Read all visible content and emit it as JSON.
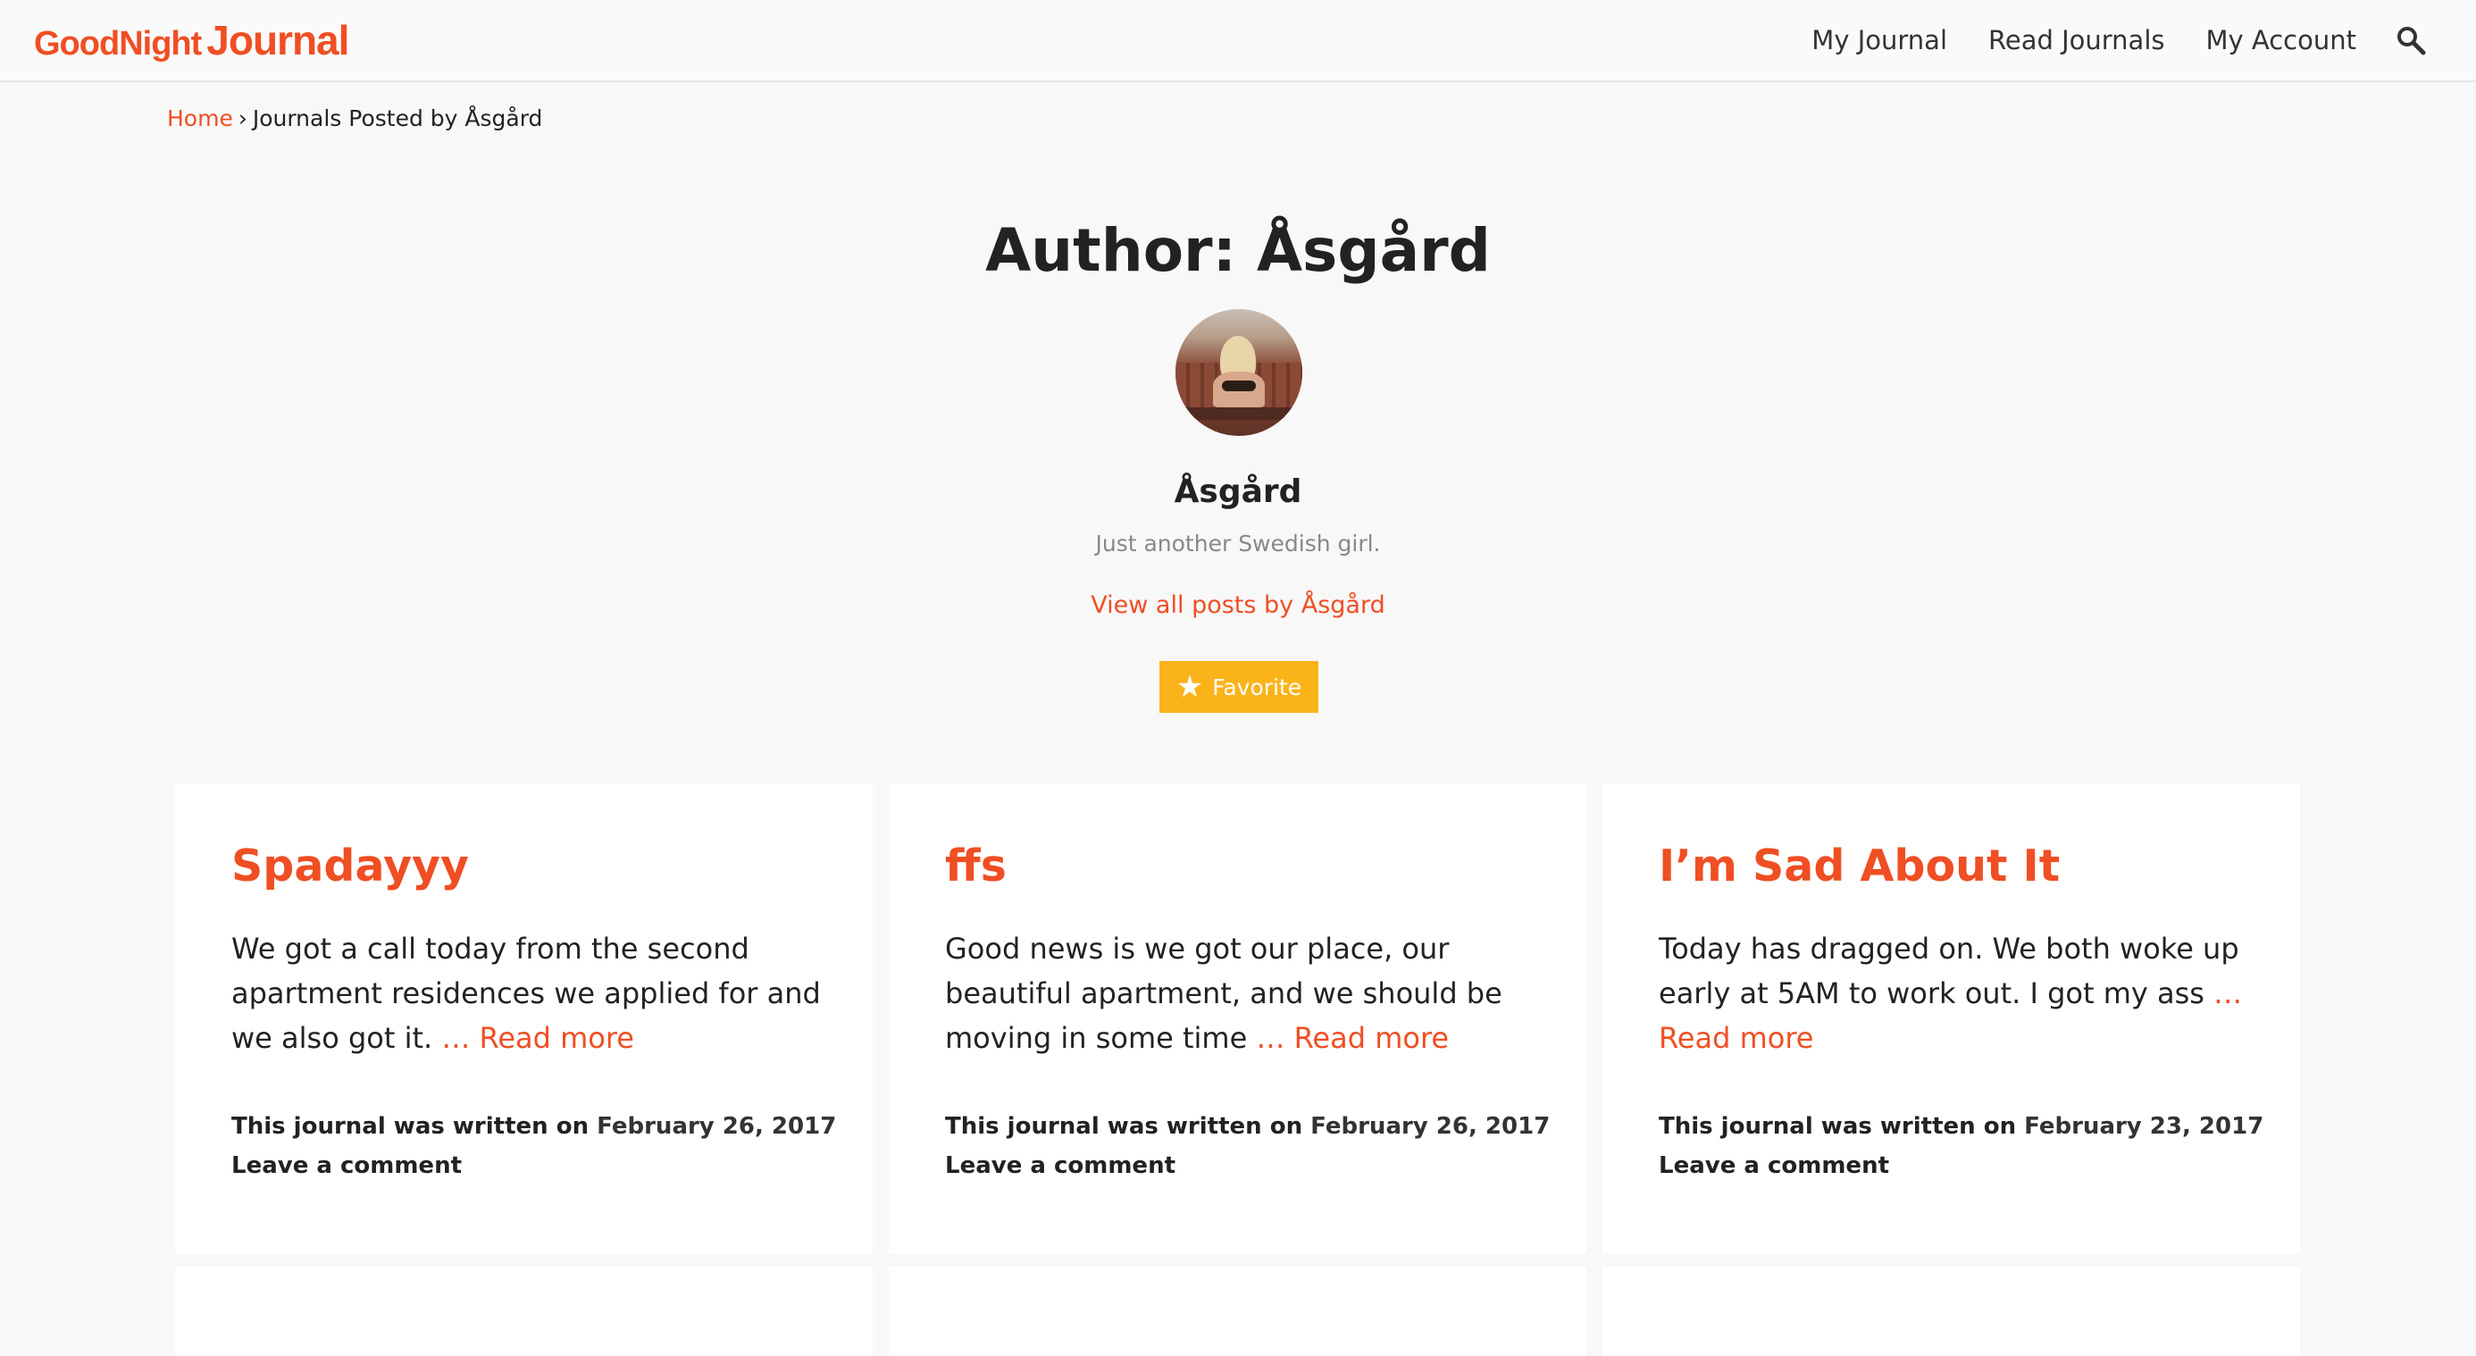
{
  "header": {
    "logo_part1": "GoodNight",
    "logo_part2": "Journal",
    "nav": [
      {
        "label": "My Journal"
      },
      {
        "label": "Read Journals"
      },
      {
        "label": "My Account"
      }
    ],
    "search_icon": "search-icon"
  },
  "breadcrumb": {
    "home": "Home",
    "separator": "›",
    "current": "Journals Posted by Åsgård"
  },
  "author": {
    "title": "Author: Åsgård",
    "name": "Åsgård",
    "bio": "Just another Swedish girl.",
    "posts_link": "View all posts by Åsgård",
    "favorite_label": "Favorite",
    "favorite_icon": "star-icon"
  },
  "colors": {
    "accent": "#f04e23",
    "favorite": "#fbb31a"
  },
  "posts": [
    {
      "title": "Spadayyy",
      "excerpt": "We got a call today from the second apartment residences we applied for and we also got it. ",
      "more": "… Read more",
      "meta_prefix": "This journal was written on",
      "date": "February 26, 2017",
      "comment": "Leave a comment"
    },
    {
      "title": "ffs",
      "excerpt": "Good news is we got our place, our beautiful apartment, and we should be moving in some time ",
      "more": "… Read more",
      "meta_prefix": "This journal was written on",
      "date": "February 26, 2017",
      "comment": "Leave a comment"
    },
    {
      "title": "I’m Sad About It",
      "excerpt": "Today has dragged on.  We both woke up early at 5AM to work out. I got my ass ",
      "more": "… Read more",
      "meta_prefix": "This journal was written on",
      "date": "February 23, 2017",
      "comment": "Leave a comment"
    }
  ]
}
